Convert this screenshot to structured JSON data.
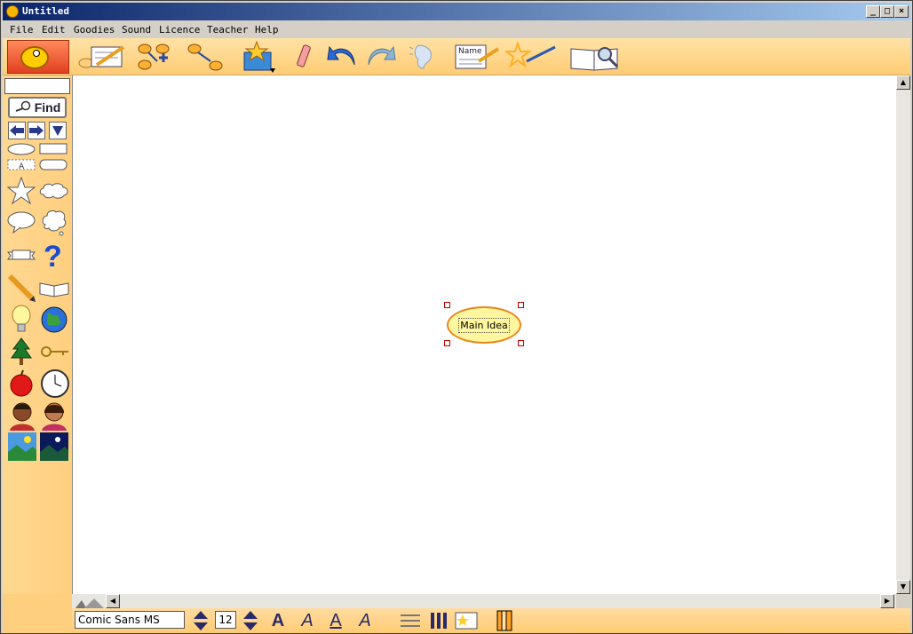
{
  "window": {
    "title": "Untitled",
    "controls": [
      "_",
      "□",
      "×"
    ]
  },
  "menu": [
    "File",
    "Edit",
    "Goodies",
    "Sound",
    "Licence",
    "Teacher",
    "Help"
  ],
  "toolbar": {
    "tools": [
      "notes-icon",
      "add-symbol-icon",
      "link-icon",
      "goodies-box-icon",
      "eraser-icon",
      "undo-icon",
      "redo-icon",
      "listen-icon",
      "name-label-icon",
      "shape-paint-icon",
      "dictionary-icon"
    ]
  },
  "sidebar": {
    "search_value": "",
    "find_label": "Find",
    "symbols": [
      "oval",
      "rectangle",
      "text-label",
      "rounded-rectangle",
      "star",
      "cloud",
      "speech-bubble",
      "thought-bubble",
      "banner",
      "question-mark",
      "pencil",
      "book",
      "light-bulb",
      "globe",
      "tree",
      "key",
      "apple",
      "clock",
      "boy",
      "girl",
      "day-landscape",
      "night-landscape"
    ]
  },
  "canvas": {
    "main_idea": "Main Idea"
  },
  "format_bar": {
    "font_name": "Comic Sans MS",
    "font_size": "12",
    "bold_glyph": "A",
    "italic_glyph": "A",
    "underline_glyph": "A",
    "color_glyph": "A"
  },
  "colors": {
    "accent": "#ffcc74",
    "title_bar": "#0a246a",
    "idea_fill": "#fff7a0",
    "idea_border": "#e8871e"
  }
}
